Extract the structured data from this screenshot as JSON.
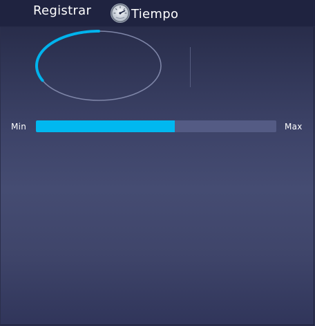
{
  "header": {
    "tabs": [
      {
        "label": "Registrar"
      },
      {
        "label": "Tiempo",
        "icon": "speedometer-icon"
      }
    ]
  },
  "gauge": {
    "progress_fraction": 0.32,
    "accent_color": "#00b3ed",
    "track_color": "#7f86a8"
  },
  "range_bar": {
    "min_label": "Min",
    "max_label": "Max",
    "fill_fraction": 0.578,
    "fill_color": "#00b8f0",
    "track_color": "#545b84"
  }
}
